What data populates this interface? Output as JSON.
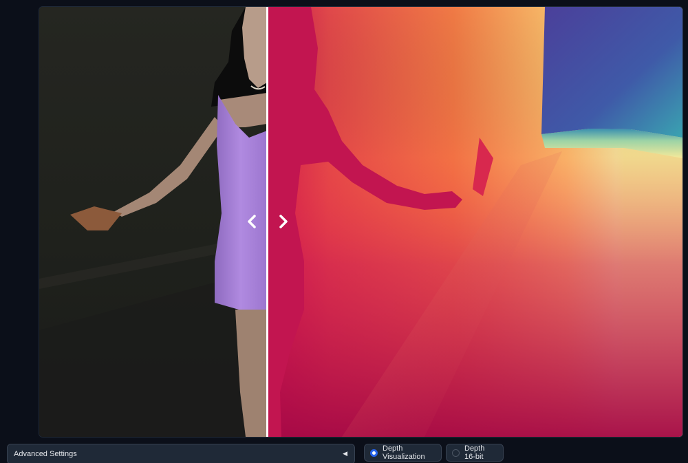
{
  "compare_viewer": {
    "left_image": "original-photo",
    "right_image": "depth-map",
    "slider_position_percent": 35.5,
    "left_arrow_icon": "chevron-left-icon",
    "right_arrow_icon": "chevron-right-icon"
  },
  "advanced_settings": {
    "label": "Advanced Settings",
    "caret_icon": "caret-left-icon",
    "caret_glyph": "◀"
  },
  "output_mode": {
    "options": [
      {
        "label": "Depth Visualization",
        "selected": true
      },
      {
        "label": "Depth 16-bit",
        "selected": false
      }
    ]
  },
  "colors": {
    "background": "#0b0f19",
    "panel": "#1f2937",
    "border": "#374151",
    "accent": "#2563eb",
    "dress": "#a37bd0"
  }
}
